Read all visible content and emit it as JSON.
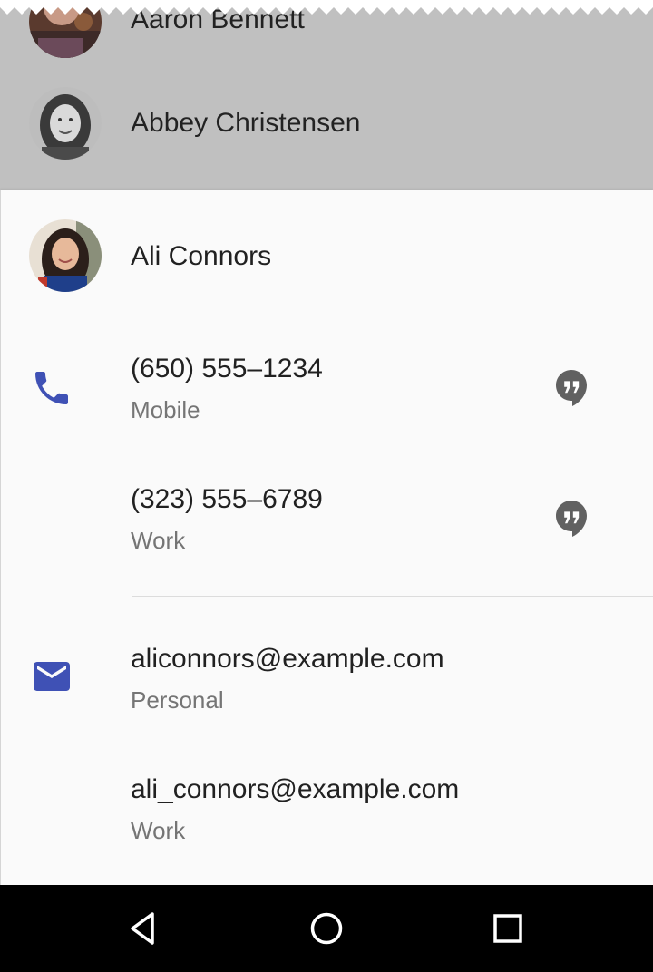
{
  "background_list": [
    {
      "name": "Aaron Bennett"
    },
    {
      "name": "Abbey Christensen"
    }
  ],
  "contact": {
    "name": "Ali Connors",
    "phones": [
      {
        "number": "(650) 555–1234",
        "type": "Mobile",
        "action_icon": "hangouts-icon"
      },
      {
        "number": "(323) 555–6789",
        "type": "Work",
        "action_icon": "hangouts-icon"
      }
    ],
    "emails": [
      {
        "address": "aliconnors@example.com",
        "type": "Personal"
      },
      {
        "address": "ali_connors@example.com",
        "type": "Work"
      }
    ]
  },
  "icons": {
    "phone": "phone-icon",
    "email": "email-icon",
    "hangouts": "hangouts-icon"
  },
  "colors": {
    "accent": "#3f51b5",
    "hangouts": "#616161",
    "dim_overlay": "#c0c0c0",
    "sheet": "#fafafa"
  },
  "navigation": [
    "back-icon",
    "home-icon",
    "recents-icon"
  ]
}
